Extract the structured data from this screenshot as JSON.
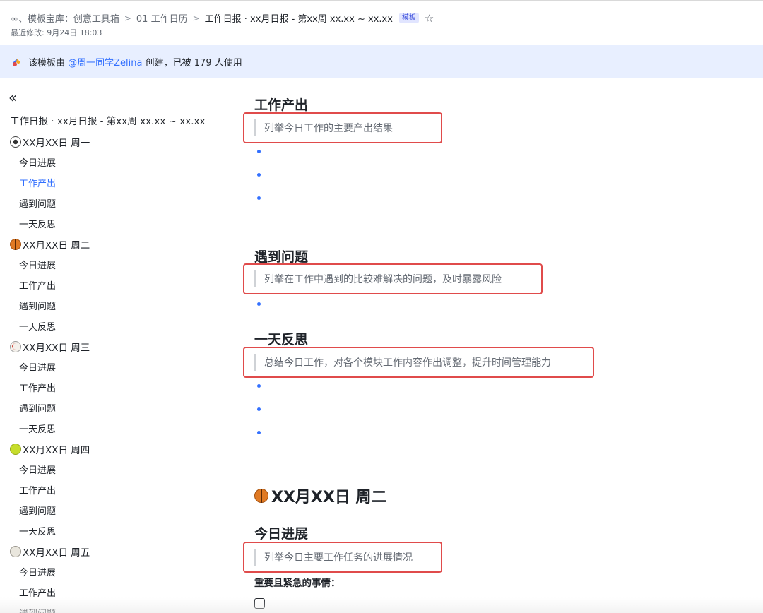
{
  "header": {
    "breadcrumbs": [
      "∞、模板宝库：创意工具箱",
      "01 工作日历",
      "工作日报 · xx月日报 - 第xx周 xx.xx ~ xx.xx"
    ],
    "tag": "模板",
    "modified": "最近修改: 9月24日 18:03"
  },
  "banner": {
    "prefix": "该模板由",
    "author": "@周一同学Zelina",
    "suffix": "创建，已被 179 人使用"
  },
  "sidebar": {
    "collapse_icon": "«",
    "title": "工作日报 · xx月日报 - 第xx周 xx.xx ~ xx.xx",
    "days": [
      {
        "label": "XX月XX日 周一",
        "icon": "soccer-ball-icon",
        "items": [
          "今日进展",
          "工作产出",
          "遇到问题",
          "一天反思"
        ]
      },
      {
        "label": "XX月XX日 周二",
        "icon": "basketball-icon",
        "items": [
          "今日进展",
          "工作产出",
          "遇到问题",
          "一天反思"
        ]
      },
      {
        "label": "XX月XX日 周三",
        "icon": "baseball-icon",
        "items": [
          "今日进展",
          "工作产出",
          "遇到问题",
          "一天反思"
        ]
      },
      {
        "label": "XX月XX日 周四",
        "icon": "tennis-ball-icon",
        "items": [
          "今日进展",
          "工作产出",
          "遇到问题",
          "一天反思"
        ]
      },
      {
        "label": "XX月XX日 周五",
        "icon": "softball-icon",
        "items": [
          "今日进展",
          "工作产出",
          "遇到问题"
        ]
      }
    ],
    "active_item": "工作产出"
  },
  "main": {
    "section_output": {
      "heading": "工作产出",
      "hint": "列举今日工作的主要产出结果"
    },
    "section_issues": {
      "heading": "遇到问题",
      "hint": "列举在工作中遇到的比较难解决的问题，及时暴露风险"
    },
    "section_reflect": {
      "heading": "一天反思",
      "hint": "总结今日工作，对各个模块工作内容作出调整，提升时间管理能力"
    },
    "day_heading": "XX月XX日 周二",
    "section_progress": {
      "heading": "今日进展",
      "hint": "列举今日主要工作任务的进展情况"
    },
    "important_label": "重要且紧急的事情："
  },
  "colors": {
    "accent": "#3370ff",
    "highlight_box": "#e04b4b",
    "banner_bg": "#e8efff"
  }
}
